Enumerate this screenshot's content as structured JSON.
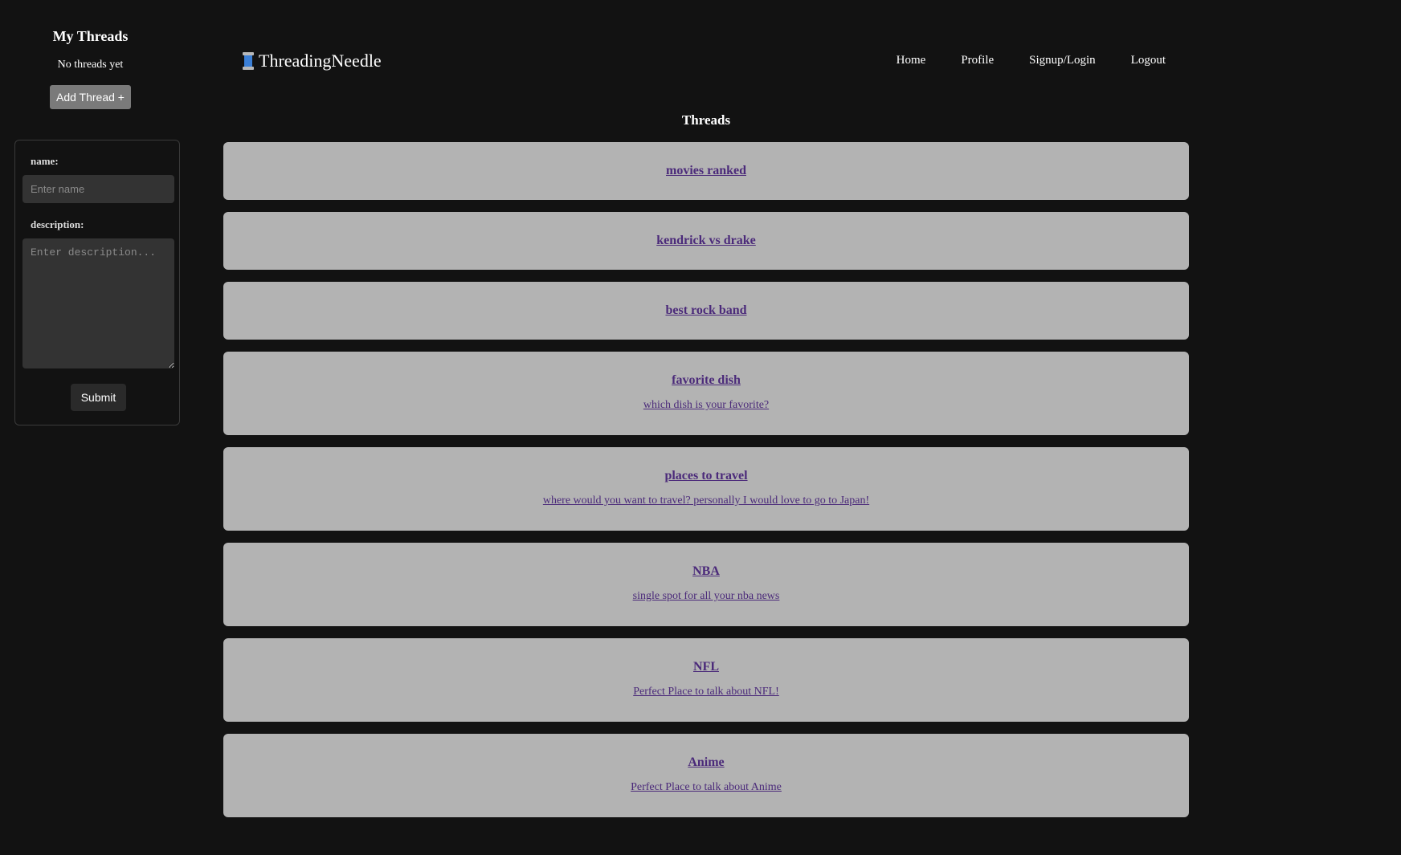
{
  "sidebar": {
    "title": "My Threads",
    "empty_text": "No threads yet",
    "add_button": "Add Thread +",
    "form": {
      "name_label": "name:",
      "name_placeholder": "Enter name",
      "name_value": "",
      "description_label": "description:",
      "description_placeholder": "Enter description...",
      "description_value": "",
      "submit_label": "Submit"
    }
  },
  "header": {
    "brand": "ThreadingNeedle",
    "brand_icon": "spool-of-thread-icon",
    "nav": [
      "Home",
      "Profile",
      "Signup/Login",
      "Logout"
    ]
  },
  "main": {
    "heading": "Threads",
    "threads": [
      {
        "title": "movies ranked",
        "description": ""
      },
      {
        "title": "kendrick vs drake",
        "description": ""
      },
      {
        "title": "best rock band",
        "description": ""
      },
      {
        "title": "favorite dish",
        "description": "which dish is your favorite?"
      },
      {
        "title": "places to travel",
        "description": "where would you want to travel? personally I would love to go to Japan!"
      },
      {
        "title": "NBA",
        "description": "single spot for all your nba news"
      },
      {
        "title": "NFL",
        "description": "Perfect Place to talk about NFL!"
      },
      {
        "title": "Anime",
        "description": "Perfect Place to talk about Anime"
      }
    ]
  },
  "colors": {
    "background": "#121212",
    "card": "#b3b3b3",
    "link": "#4b2a7a",
    "add_button": "#7a7a7a",
    "input": "#333333"
  }
}
